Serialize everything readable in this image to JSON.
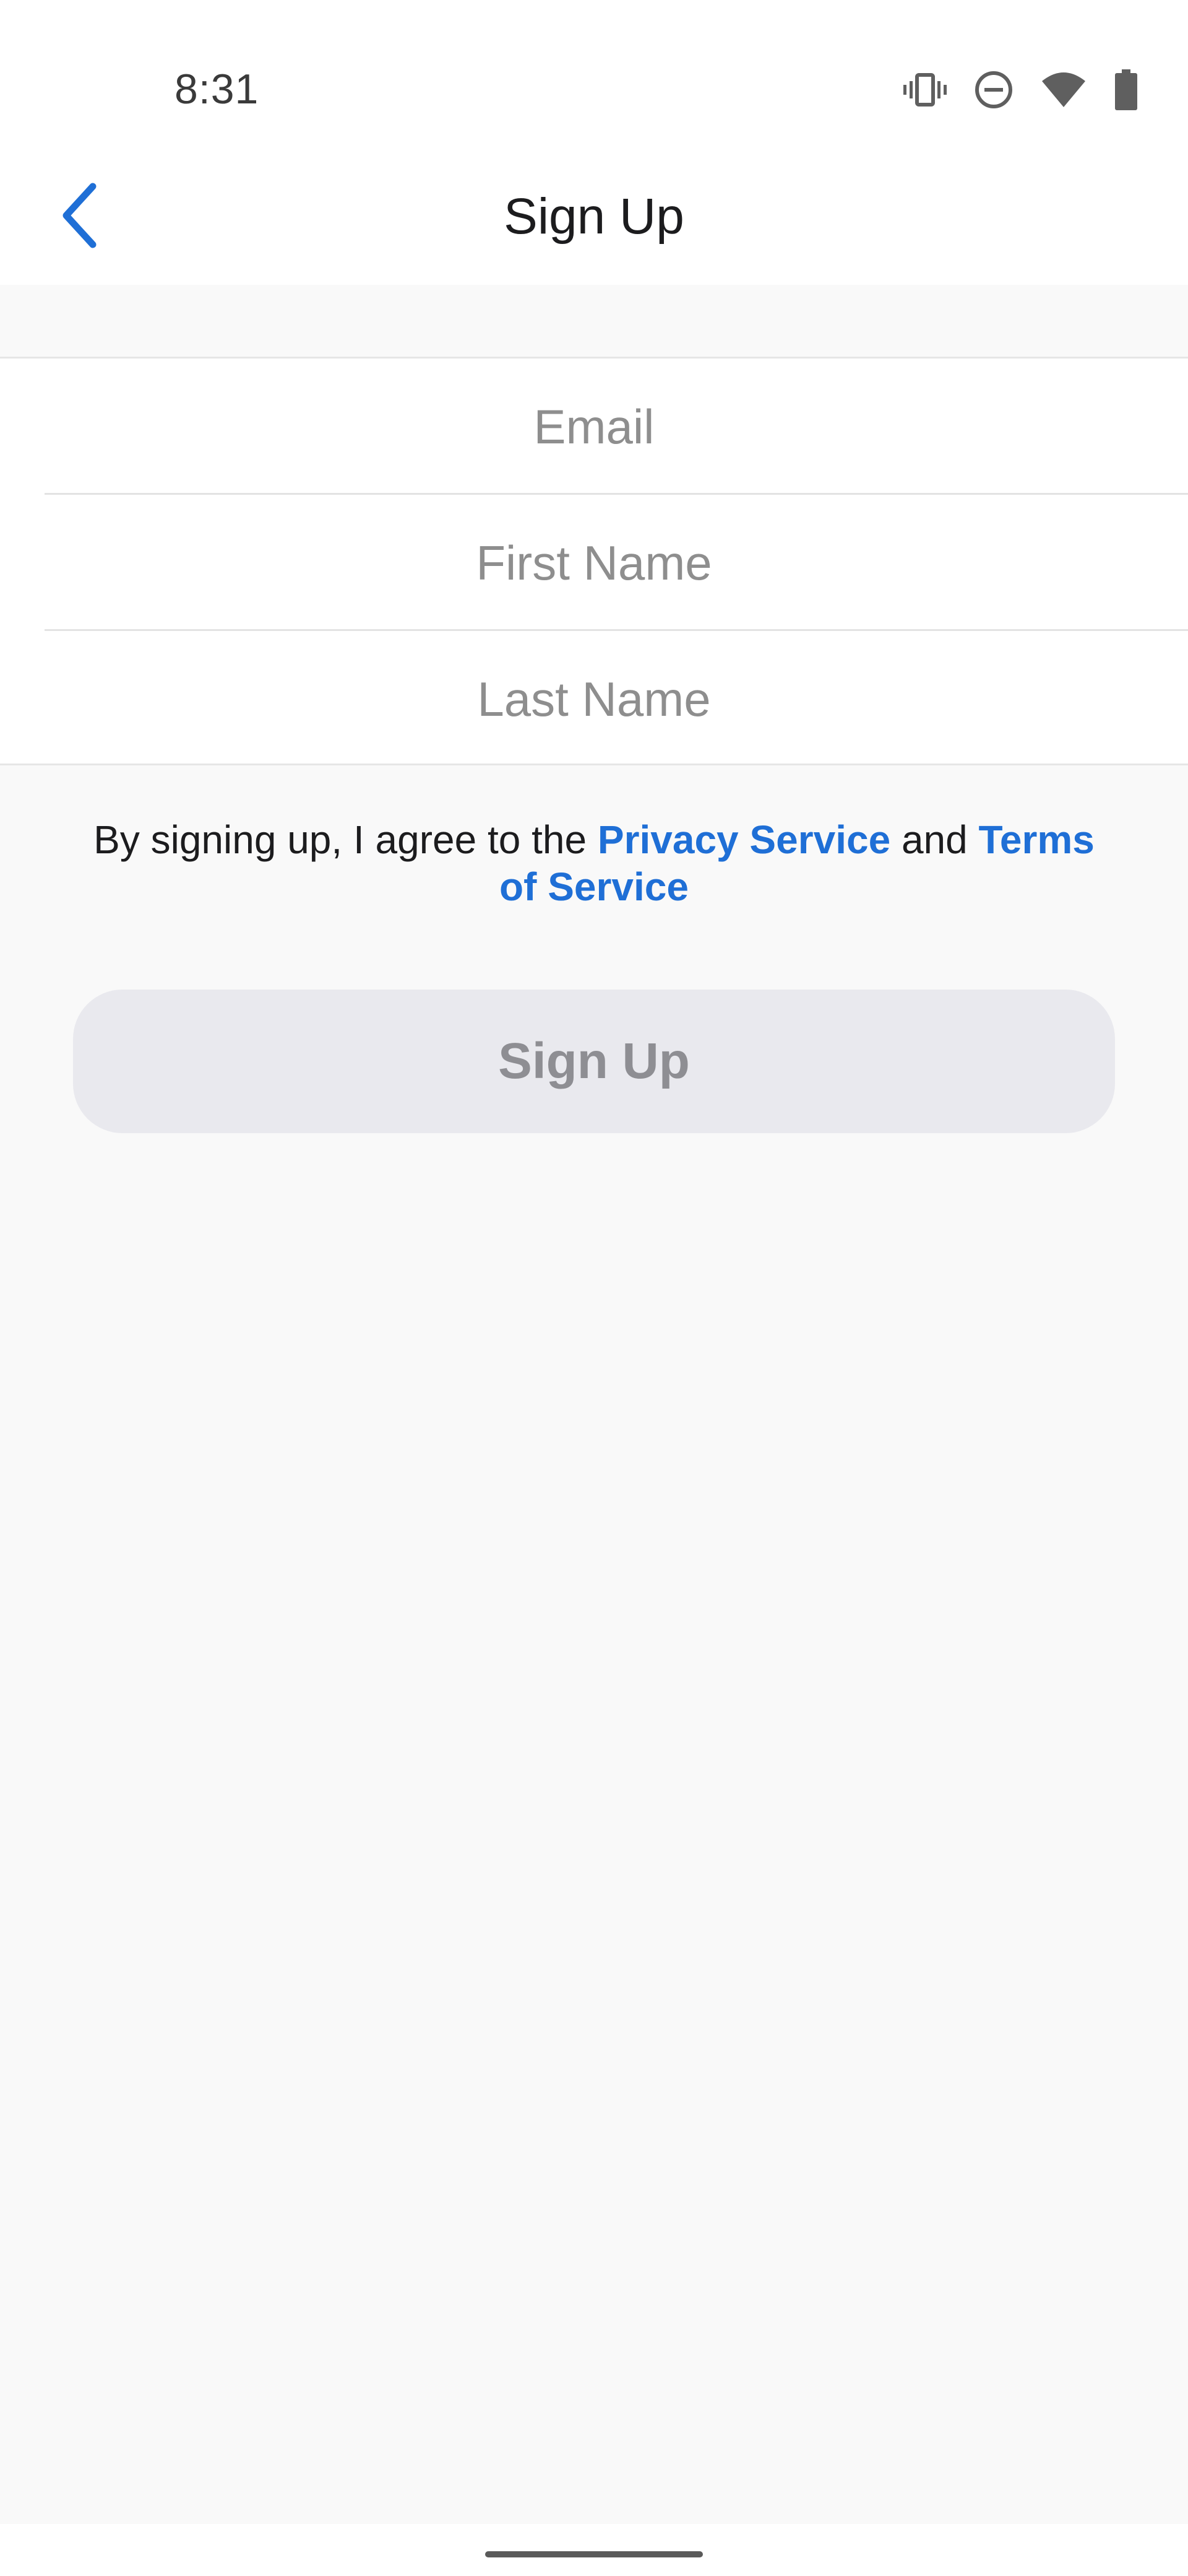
{
  "status_bar": {
    "time": "8:31",
    "icons": [
      "vibrate-icon",
      "do-not-disturb-icon",
      "wifi-icon",
      "battery-icon"
    ]
  },
  "nav": {
    "back_icon": "chevron-left-icon",
    "title": "Sign Up"
  },
  "form": {
    "email": {
      "value": "",
      "placeholder": "Email"
    },
    "first_name": {
      "value": "",
      "placeholder": "First Name"
    },
    "last_name": {
      "value": "",
      "placeholder": "Last Name"
    }
  },
  "agreement": {
    "prefix": "By signing up, I agree to the ",
    "privacy_link": "Privacy Service",
    "middle": " and ",
    "terms_link": "Terms of Service"
  },
  "signup_button": {
    "label": "Sign Up"
  },
  "colors": {
    "accent": "#1f6fd6",
    "button_disabled_bg": "#e9e9ee",
    "button_disabled_text": "#8e8e93",
    "background": "#f9f9f9"
  }
}
